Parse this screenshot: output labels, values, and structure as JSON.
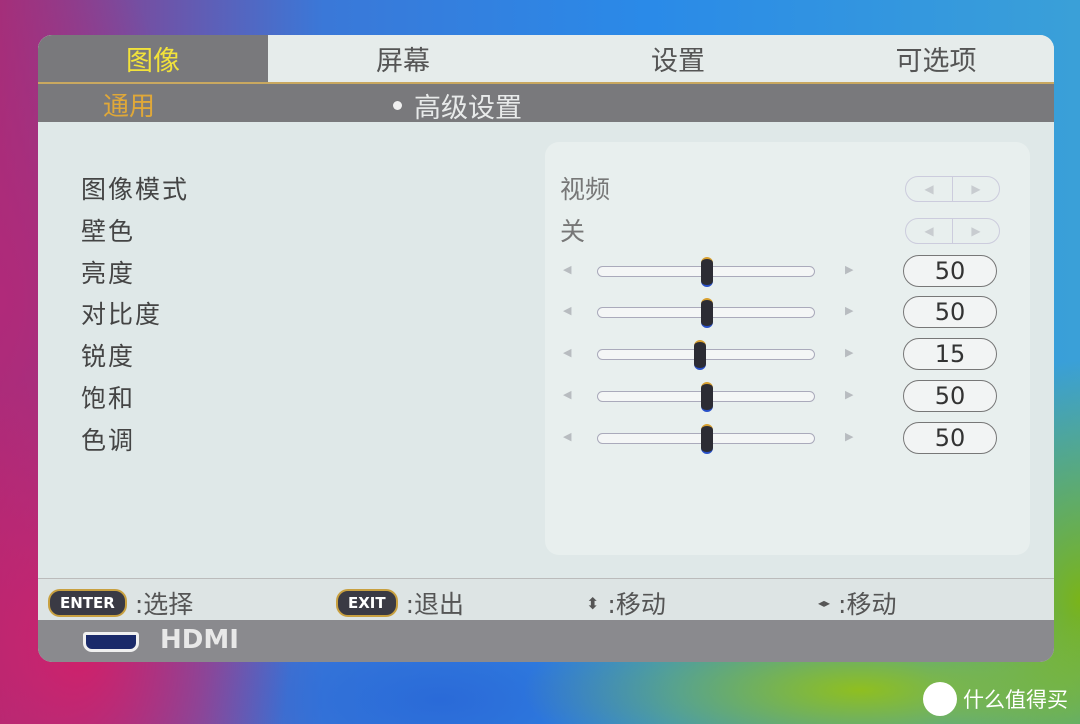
{
  "tabs": [
    {
      "label": "图像",
      "active": true
    },
    {
      "label": "屏幕"
    },
    {
      "label": "设置"
    },
    {
      "label": "可选项"
    }
  ],
  "subbar": {
    "section": "通用",
    "current": "高级设置"
  },
  "settings": [
    {
      "label": "图像模式",
      "type": "select",
      "value": "视频"
    },
    {
      "label": "壁色",
      "type": "select",
      "value": "关"
    },
    {
      "label": "亮度",
      "type": "slider",
      "value": "50",
      "level": 0.5
    },
    {
      "label": "对比度",
      "type": "slider",
      "value": "50",
      "level": 0.5
    },
    {
      "label": "锐度",
      "type": "slider",
      "value": "15",
      "level": 0.47
    },
    {
      "label": "饱和",
      "type": "slider",
      "value": "50",
      "level": 0.5
    },
    {
      "label": "色调",
      "type": "slider",
      "value": "50",
      "level": 0.5
    }
  ],
  "footer": [
    {
      "key": "ENTER",
      "action": ":选择"
    },
    {
      "key": "EXIT",
      "action": ":退出"
    },
    {
      "icon": "up-down-arrow-icon",
      "glyph": "⬍",
      "action": ":移动"
    },
    {
      "icon": "left-right-arrow-icon",
      "glyph": "◂▸",
      "action": ":移动"
    }
  ],
  "source": {
    "icon": "hdmi-icon",
    "label": "HDMI"
  },
  "watermark": {
    "logo": "值",
    "text": "什么值得买"
  },
  "colors": {
    "active_tab_text": "#f2e23a",
    "section_text": "#e0a838",
    "bar_gray": "#79797c"
  }
}
